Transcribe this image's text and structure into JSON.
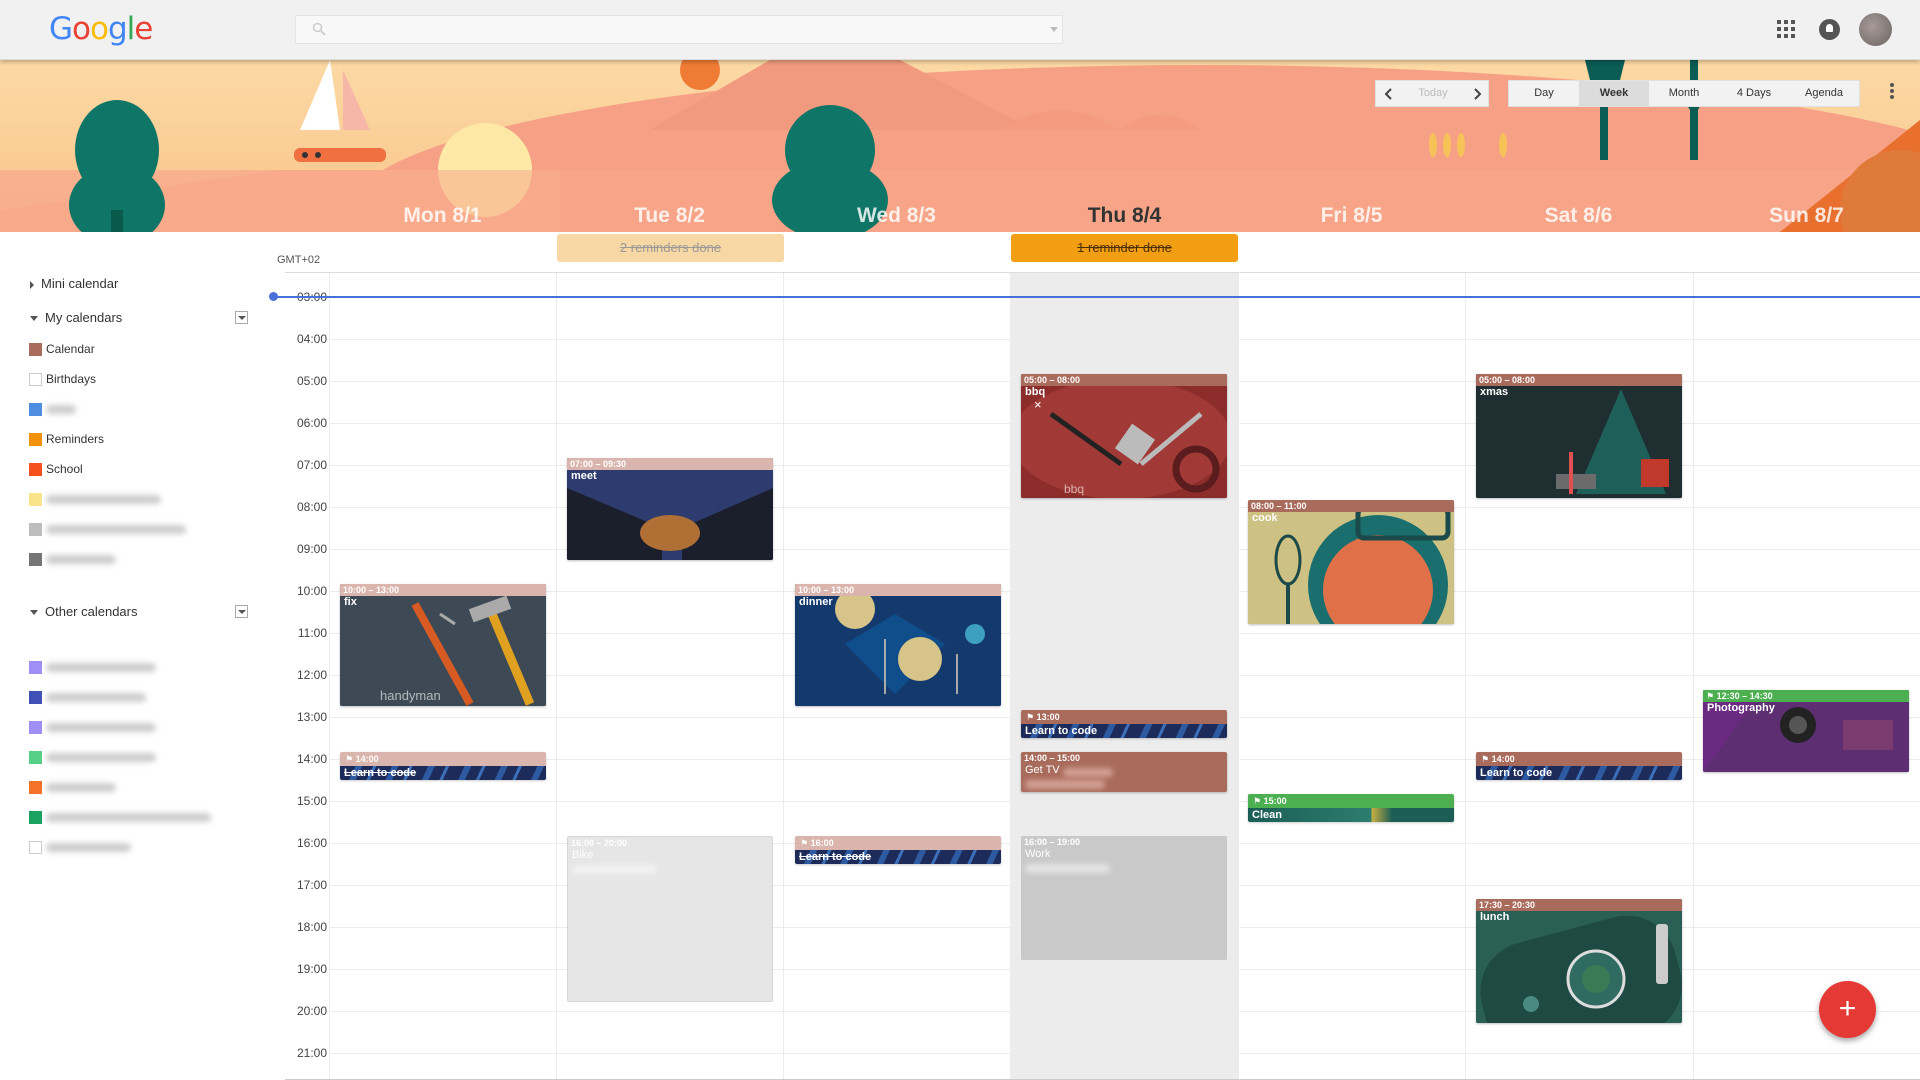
{
  "app": {
    "logo": "Google"
  },
  "search": {
    "placeholder": "",
    "value": ""
  },
  "nav": {
    "today": "Today"
  },
  "views": [
    "Day",
    "Week",
    "Month",
    "4 Days",
    "Agenda"
  ],
  "active_view": "Week",
  "timezone": "GMT+02",
  "days": [
    "Mon 8/1",
    "Tue 8/2",
    "Wed 8/3",
    "Thu 8/4",
    "Fri 8/5",
    "Sat 8/6",
    "Sun 8/7"
  ],
  "today_index": 3,
  "reminders_done": {
    "tue": "2 reminders done",
    "thu": "1 reminder done"
  },
  "sidebar": {
    "mini_calendar": "Mini calendar",
    "my_calendars": "My calendars",
    "other_calendars": "Other calendars",
    "my_items": [
      {
        "name": "Calendar",
        "color": "#a96b5c"
      },
      {
        "name": "Birthdays",
        "color": "#ffffff"
      },
      {
        "name": "",
        "color": "#4f8de0"
      },
      {
        "name": "Reminders",
        "color": "#f2920c"
      },
      {
        "name": "School",
        "color": "#f4511e"
      },
      {
        "name": "",
        "color": "#f9e48a"
      },
      {
        "name": "",
        "color": "#bdbdbd"
      },
      {
        "name": "",
        "color": "#757575"
      }
    ],
    "other_items_colors": [
      "#9e8ef5",
      "#3f51b5",
      "#9e8ef5",
      "#57d087",
      "#f4722a",
      "#1aa260",
      "#ffffff"
    ]
  },
  "hours": [
    "03:00",
    "04:00",
    "05:00",
    "06:00",
    "07:00",
    "08:00",
    "09:00",
    "10:00",
    "11:00",
    "12:00",
    "13:00",
    "14:00",
    "15:00",
    "16:00",
    "17:00",
    "18:00",
    "19:00",
    "20:00",
    "21:00"
  ],
  "events": {
    "meet": {
      "time": "07:00 – 09:30",
      "title": "meet"
    },
    "fix": {
      "time": "10:00 – 13:00",
      "title": "fix",
      "caption": "handyman"
    },
    "dinner": {
      "time": "10:00 – 13:00",
      "title": "dinner"
    },
    "bbq": {
      "time": "05:00 – 08:00",
      "title": "bbq",
      "caption": "bbq"
    },
    "cook": {
      "time": "08:00 – 11:00",
      "title": "cook"
    },
    "xmas": {
      "time": "05:00 – 08:00",
      "title": "xmas"
    },
    "gettv": {
      "time": "14:00 – 15:00",
      "title": "Get TV"
    },
    "work": {
      "time": "16:00 – 19:00",
      "title": "Work"
    },
    "tue_gray": {
      "time": "16:00 – 20:00",
      "title": "Bike"
    },
    "lunch": {
      "time": "17:30 – 20:30",
      "title": "lunch"
    },
    "photo": {
      "time": "12:30 – 14:30",
      "title": "Photography"
    },
    "clean": {
      "time": "15:00",
      "title": "Clean"
    }
  },
  "reminders": {
    "mon": {
      "time": "14:00",
      "title": "Learn to code"
    },
    "wed": {
      "time": "16:00",
      "title": "Learn to code"
    },
    "thu": {
      "time": "13:00",
      "title": "Learn to code"
    },
    "sat": {
      "time": "14:00",
      "title": "Learn to code"
    }
  },
  "fab": "+"
}
